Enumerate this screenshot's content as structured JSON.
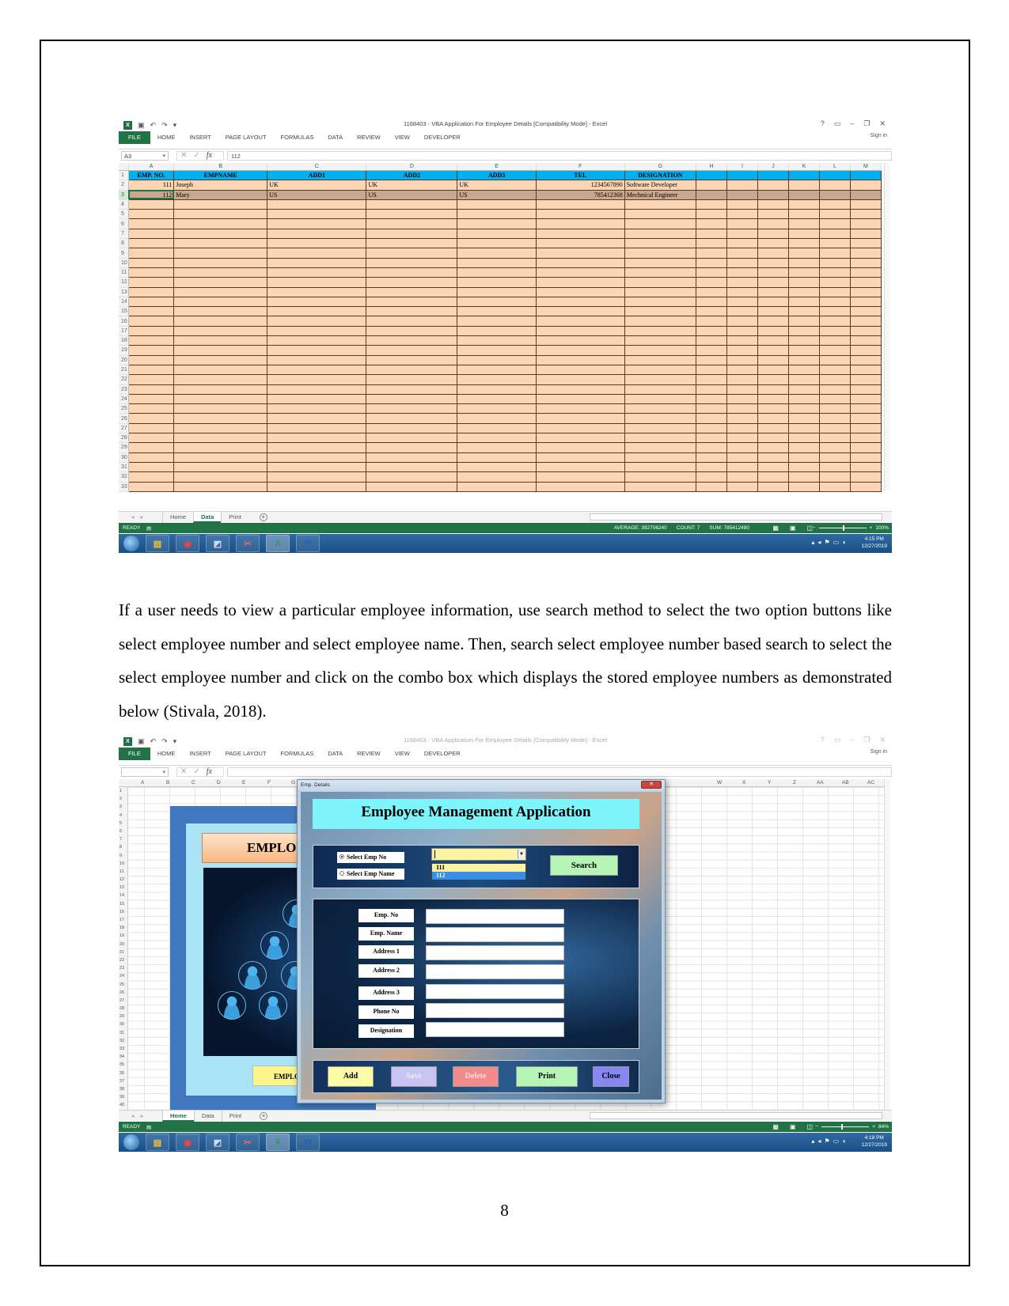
{
  "excel": {
    "quick_access": {
      "undo": "↶",
      "redo": "↷",
      "customize": "▾"
    },
    "window_title": "1168403 - VBA Application For Employee Details [Compatibility Mode] - Excel",
    "window_controls": [
      "?",
      "▭",
      "–",
      "❐",
      "✕"
    ],
    "ribbon_tabs": [
      "FILE",
      "HOME",
      "INSERT",
      "PAGE LAYOUT",
      "FORMULAS",
      "DATA",
      "REVIEW",
      "VIEW",
      "DEVELOPER"
    ],
    "sign_in": "Sign in",
    "fx_label": "fx"
  },
  "screenshot1": {
    "name_box": "A3",
    "formula_value": "112",
    "column_letters": [
      "A",
      "B",
      "C",
      "D",
      "E",
      "F",
      "G",
      "H",
      "I",
      "J",
      "K",
      "L",
      "M"
    ],
    "headers": [
      "EMP. NO.",
      "EMPNAME",
      "ADD1",
      "ADD2",
      "ADD3",
      "TEL",
      "DESIGNATION"
    ],
    "rows": [
      {
        "row": "2",
        "cells": [
          "111",
          "Joseph",
          "UK",
          "UK",
          "UK",
          "1234567890",
          "Software Developer"
        ]
      },
      {
        "row": "3",
        "cells": [
          "112",
          "Mary",
          "US",
          "US",
          "US",
          "785412368",
          "Mechnical Engineer"
        ]
      }
    ],
    "row_numbers": [
      "1",
      "2",
      "3",
      "4",
      "5",
      "6",
      "7",
      "8",
      "9",
      "10",
      "11",
      "12",
      "13",
      "14",
      "15",
      "16",
      "17",
      "18",
      "19",
      "20",
      "21",
      "22",
      "23",
      "24",
      "25",
      "26",
      "27",
      "28",
      "29",
      "30",
      "31",
      "32",
      "33"
    ],
    "sheet_tabs": [
      "Home",
      "Data",
      "Print"
    ],
    "active_sheet": "Data",
    "status": {
      "mode": "READY",
      "average": "AVERAGE: 392706240",
      "count": "COUNT: 7",
      "sum": "SUM: 785412480",
      "zoom": "100%"
    },
    "clock": {
      "time": "4:15 PM",
      "date": "12/27/2019"
    }
  },
  "paragraph": "If a user needs to view a particular employee information, use search method to select the two option buttons like select employee number and select employee name. Then, search select employee number based search to select the select employee number and click on the combo box which displays the stored employee numbers as demonstrated below (Stivala, 2018).",
  "screenshot2": {
    "name_box": "",
    "formula_value": "",
    "column_letters": [
      "A",
      "B",
      "C",
      "D",
      "E",
      "F",
      "G",
      "W",
      "X",
      "Y",
      "Z",
      "AA",
      "AB",
      "AC"
    ],
    "row_numbers": [
      "1",
      "2",
      "3",
      "4",
      "5",
      "6",
      "7",
      "8",
      "9",
      "10",
      "11",
      "12",
      "13",
      "14",
      "15",
      "16",
      "17",
      "18",
      "19",
      "20",
      "21",
      "22",
      "23",
      "24",
      "25",
      "26",
      "27",
      "28",
      "29",
      "30",
      "31",
      "32",
      "33",
      "34",
      "35",
      "36",
      "37",
      "38",
      "39",
      "40",
      "41"
    ],
    "home_panel": {
      "title": "EMPLOYEE",
      "button": "EMPLOYEE"
    },
    "userform": {
      "window_title": "Emp. Details",
      "close": "✕",
      "heading": "Employee Management Application",
      "radio_options": [
        {
          "label": "Select Emp No",
          "selected": true
        },
        {
          "label": "Select Emp Name",
          "selected": false
        }
      ],
      "combo_value": "",
      "combo_options": [
        "111",
        "112"
      ],
      "combo_highlighted": "112",
      "search_button": "Search",
      "fields": [
        {
          "label": "Emp. No",
          "value": ""
        },
        {
          "label": "Emp. Name",
          "value": ""
        },
        {
          "label": "Address 1",
          "value": ""
        },
        {
          "label": "Address 2",
          "value": ""
        },
        {
          "label": "Address 3",
          "value": ""
        },
        {
          "label": "Phone No",
          "value": ""
        },
        {
          "label": "Designation",
          "value": ""
        }
      ],
      "buttons": {
        "add": "Add",
        "save": "Save",
        "delete": "Delete",
        "print": "Print",
        "close": "Close"
      }
    },
    "sheet_tabs": [
      "Home",
      "Data",
      "Print"
    ],
    "active_sheet": "Home",
    "status": {
      "mode": "READY",
      "zoom": "84%"
    },
    "clock": {
      "time": "4:18 PM",
      "date": "12/27/2019"
    }
  },
  "page_number": "8"
}
